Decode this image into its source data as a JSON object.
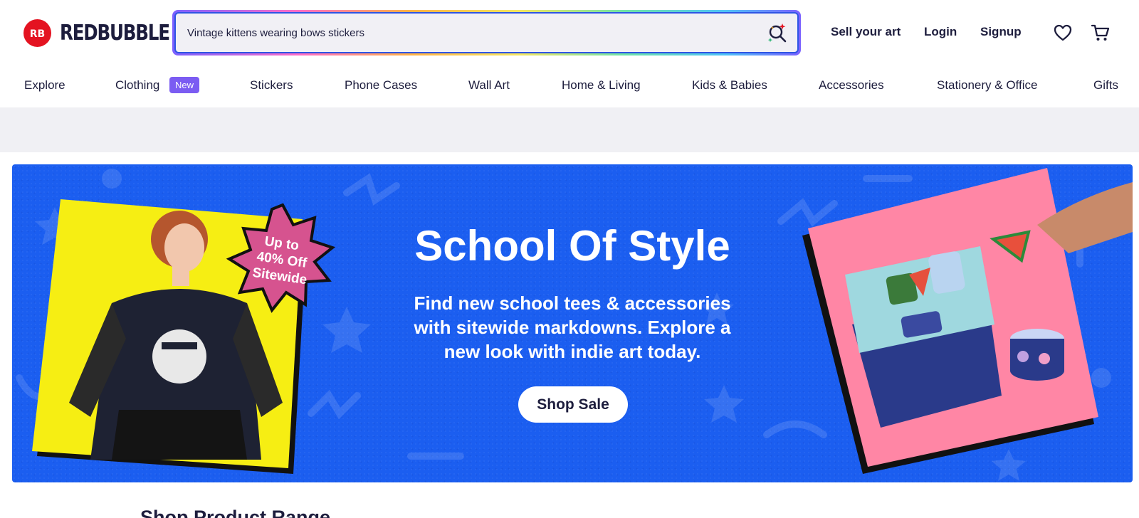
{
  "brand": {
    "name": "REDBUBBLE",
    "logo_letters": "RB",
    "color": "#e41321"
  },
  "search": {
    "value": "Vintage kittens wearing bows stickers",
    "icon": "search-sparkle-icon"
  },
  "header_links": {
    "sell": "Sell your art",
    "login": "Login",
    "signup": "Signup"
  },
  "header_icons": [
    "heart-icon",
    "cart-icon"
  ],
  "nav": {
    "items": [
      "Explore",
      "Clothing",
      "Stickers",
      "Phone Cases",
      "Wall Art",
      "Home & Living",
      "Kids & Babies",
      "Accessories",
      "Stationery & Office",
      "Gifts"
    ],
    "clothing_badge": "New"
  },
  "hero": {
    "title": "School Of Style",
    "subtitle": "Find new school tees & accessories with sitewide markdowns. Explore a new look with indie art today.",
    "button": "Shop Sale",
    "burst": {
      "line1": "Up to",
      "line2": "40% Off",
      "line3": "Sitewide"
    },
    "colors": {
      "background": "#1b5ef0",
      "left_card": "#f6ee13",
      "right_card": "#ff86a5",
      "burst": "#d6538f"
    }
  },
  "section": {
    "title": "Shop Product Range"
  }
}
